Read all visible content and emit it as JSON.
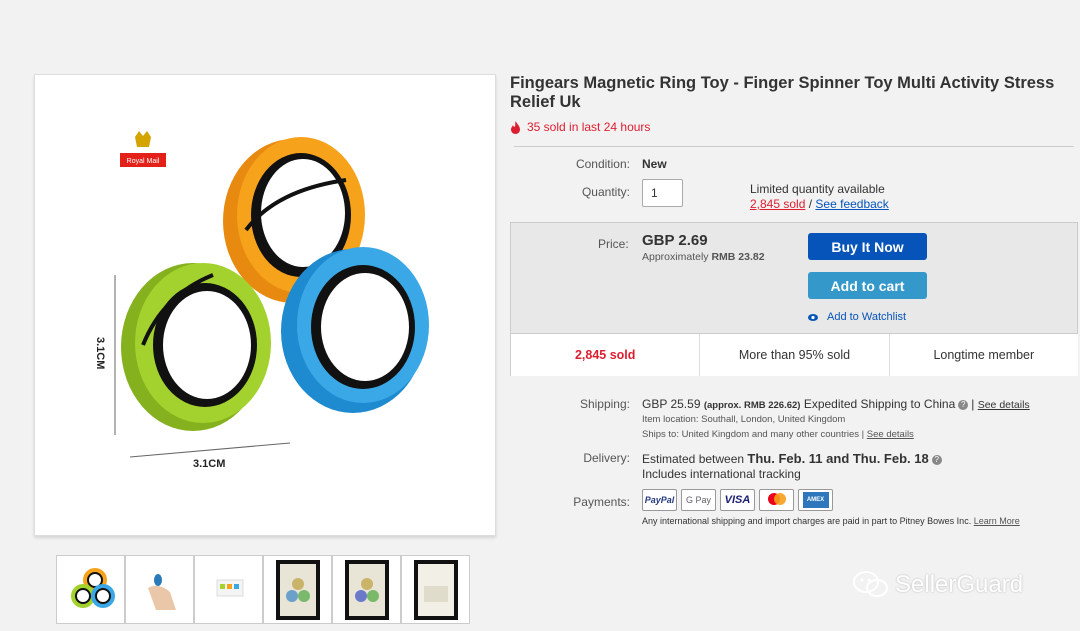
{
  "product": {
    "title": "Fingears Magnetic Ring Toy - Finger Spinner Toy Multi Activity Stress Relief Uk",
    "sold_24h": "35 sold in last 24 hours",
    "royal_mail_label": "Royal Mail",
    "dimension_label_side": "3.1CM",
    "dimension_label_bottom": "3.1CM"
  },
  "details": {
    "condition_label": "Condition:",
    "condition_value": "New",
    "quantity_label": "Quantity:",
    "quantity_value": "1",
    "limited_text": "Limited quantity available",
    "sold_link": "2,845 sold",
    "separator": "/",
    "feedback_link": "See feedback"
  },
  "price": {
    "label": "Price:",
    "value": "GBP 2.69",
    "approx_prefix": "Approximately",
    "approx_value": "RMB 23.82",
    "buy_now": "Buy It Now",
    "add_to_cart": "Add to cart",
    "watchlist": "Add to Watchlist"
  },
  "stats": [
    "2,845 sold",
    "More than 95% sold",
    "Longtime member"
  ],
  "shipping": {
    "label": "Shipping:",
    "value": "GBP 25.59",
    "approx": "(approx. RMB 226.62)",
    "method": "Expedited Shipping to China",
    "see_details": "See details",
    "location": "Item location:  Southall, London, United Kingdom",
    "ships_to": "Ships to:  United Kingdom and many other countries |",
    "ships_see_details": "See details"
  },
  "delivery": {
    "label": "Delivery:",
    "prefix": "Estimated between",
    "range": "Thu. Feb. 11 and Thu. Feb. 18",
    "tracking": "Includes international tracking"
  },
  "payments": {
    "label": "Payments:",
    "methods": [
      "PayPal",
      "G Pay",
      "VISA",
      "mastercard",
      "AMEX"
    ],
    "note": "Any international shipping and import charges are paid in part to Pitney Bowes Inc.",
    "learn_more": "Learn More"
  },
  "watermark": "SellerGuard",
  "colors": {
    "accent_blue": "#0654ba",
    "cart_blue": "#3498ca",
    "alert_red": "#dd1e31",
    "ring_orange": "#f7a21b",
    "ring_green": "#a3d12d",
    "ring_blue": "#3aa8e6"
  }
}
